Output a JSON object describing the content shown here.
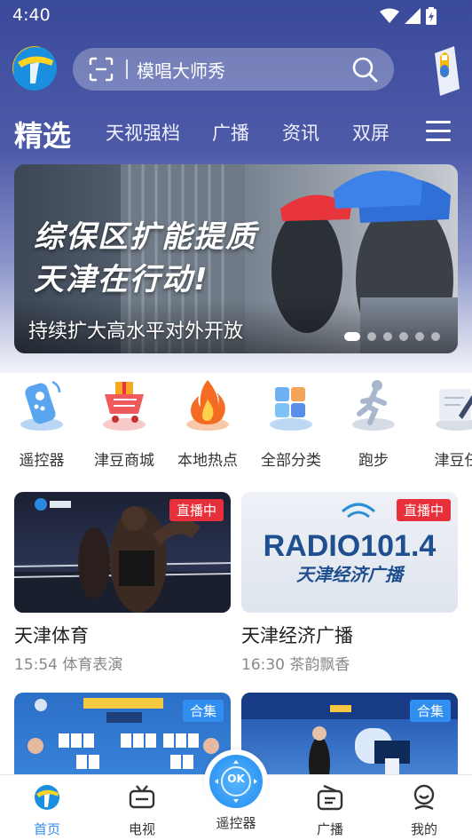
{
  "status_bar": {
    "time": "4:40"
  },
  "header": {
    "search_placeholder": "模唱大师秀"
  },
  "tabs": [
    {
      "label": "精选"
    },
    {
      "label": "天视强档"
    },
    {
      "label": "广播"
    },
    {
      "label": "资讯"
    },
    {
      "label": "双屏"
    }
  ],
  "banner": {
    "title_line1": "综保区扩能提质",
    "title_line2": "天津在行动!",
    "caption": "持续扩大高水平对外开放",
    "slide_count": 6,
    "active_slide": 1
  },
  "shortcuts": [
    {
      "label": "遥控器",
      "icon": "remote-control-icon"
    },
    {
      "label": "津豆商城",
      "icon": "shopping-cart-icon"
    },
    {
      "label": "本地热点",
      "icon": "fire-icon"
    },
    {
      "label": "全部分类",
      "icon": "category-cubes-icon"
    },
    {
      "label": "跑步",
      "icon": "running-icon"
    },
    {
      "label": "津豆任",
      "icon": "task-pen-icon"
    }
  ],
  "cards": [
    {
      "title": "天津体育",
      "subtitle": "15:54 体育表演",
      "badge": "直播中"
    },
    {
      "title": "天津经济广播",
      "subtitle": "16:30 茶韵飘香",
      "badge": "直播中",
      "thumb_text_1": "RADIO101.4",
      "thumb_text_2": "天津经济广播"
    },
    {
      "badge": "合集"
    },
    {
      "badge": "合集"
    }
  ],
  "bottom_nav": [
    {
      "label": "首页",
      "active": true
    },
    {
      "label": "电视"
    },
    {
      "label": "遥控器"
    },
    {
      "label": "广播"
    },
    {
      "label": "我的"
    }
  ],
  "remote": {
    "ok_label": "OK"
  },
  "colors": {
    "accent": "#2f8ef0",
    "live_badge": "#e8303a",
    "header_bg": "#3a4a9a"
  }
}
